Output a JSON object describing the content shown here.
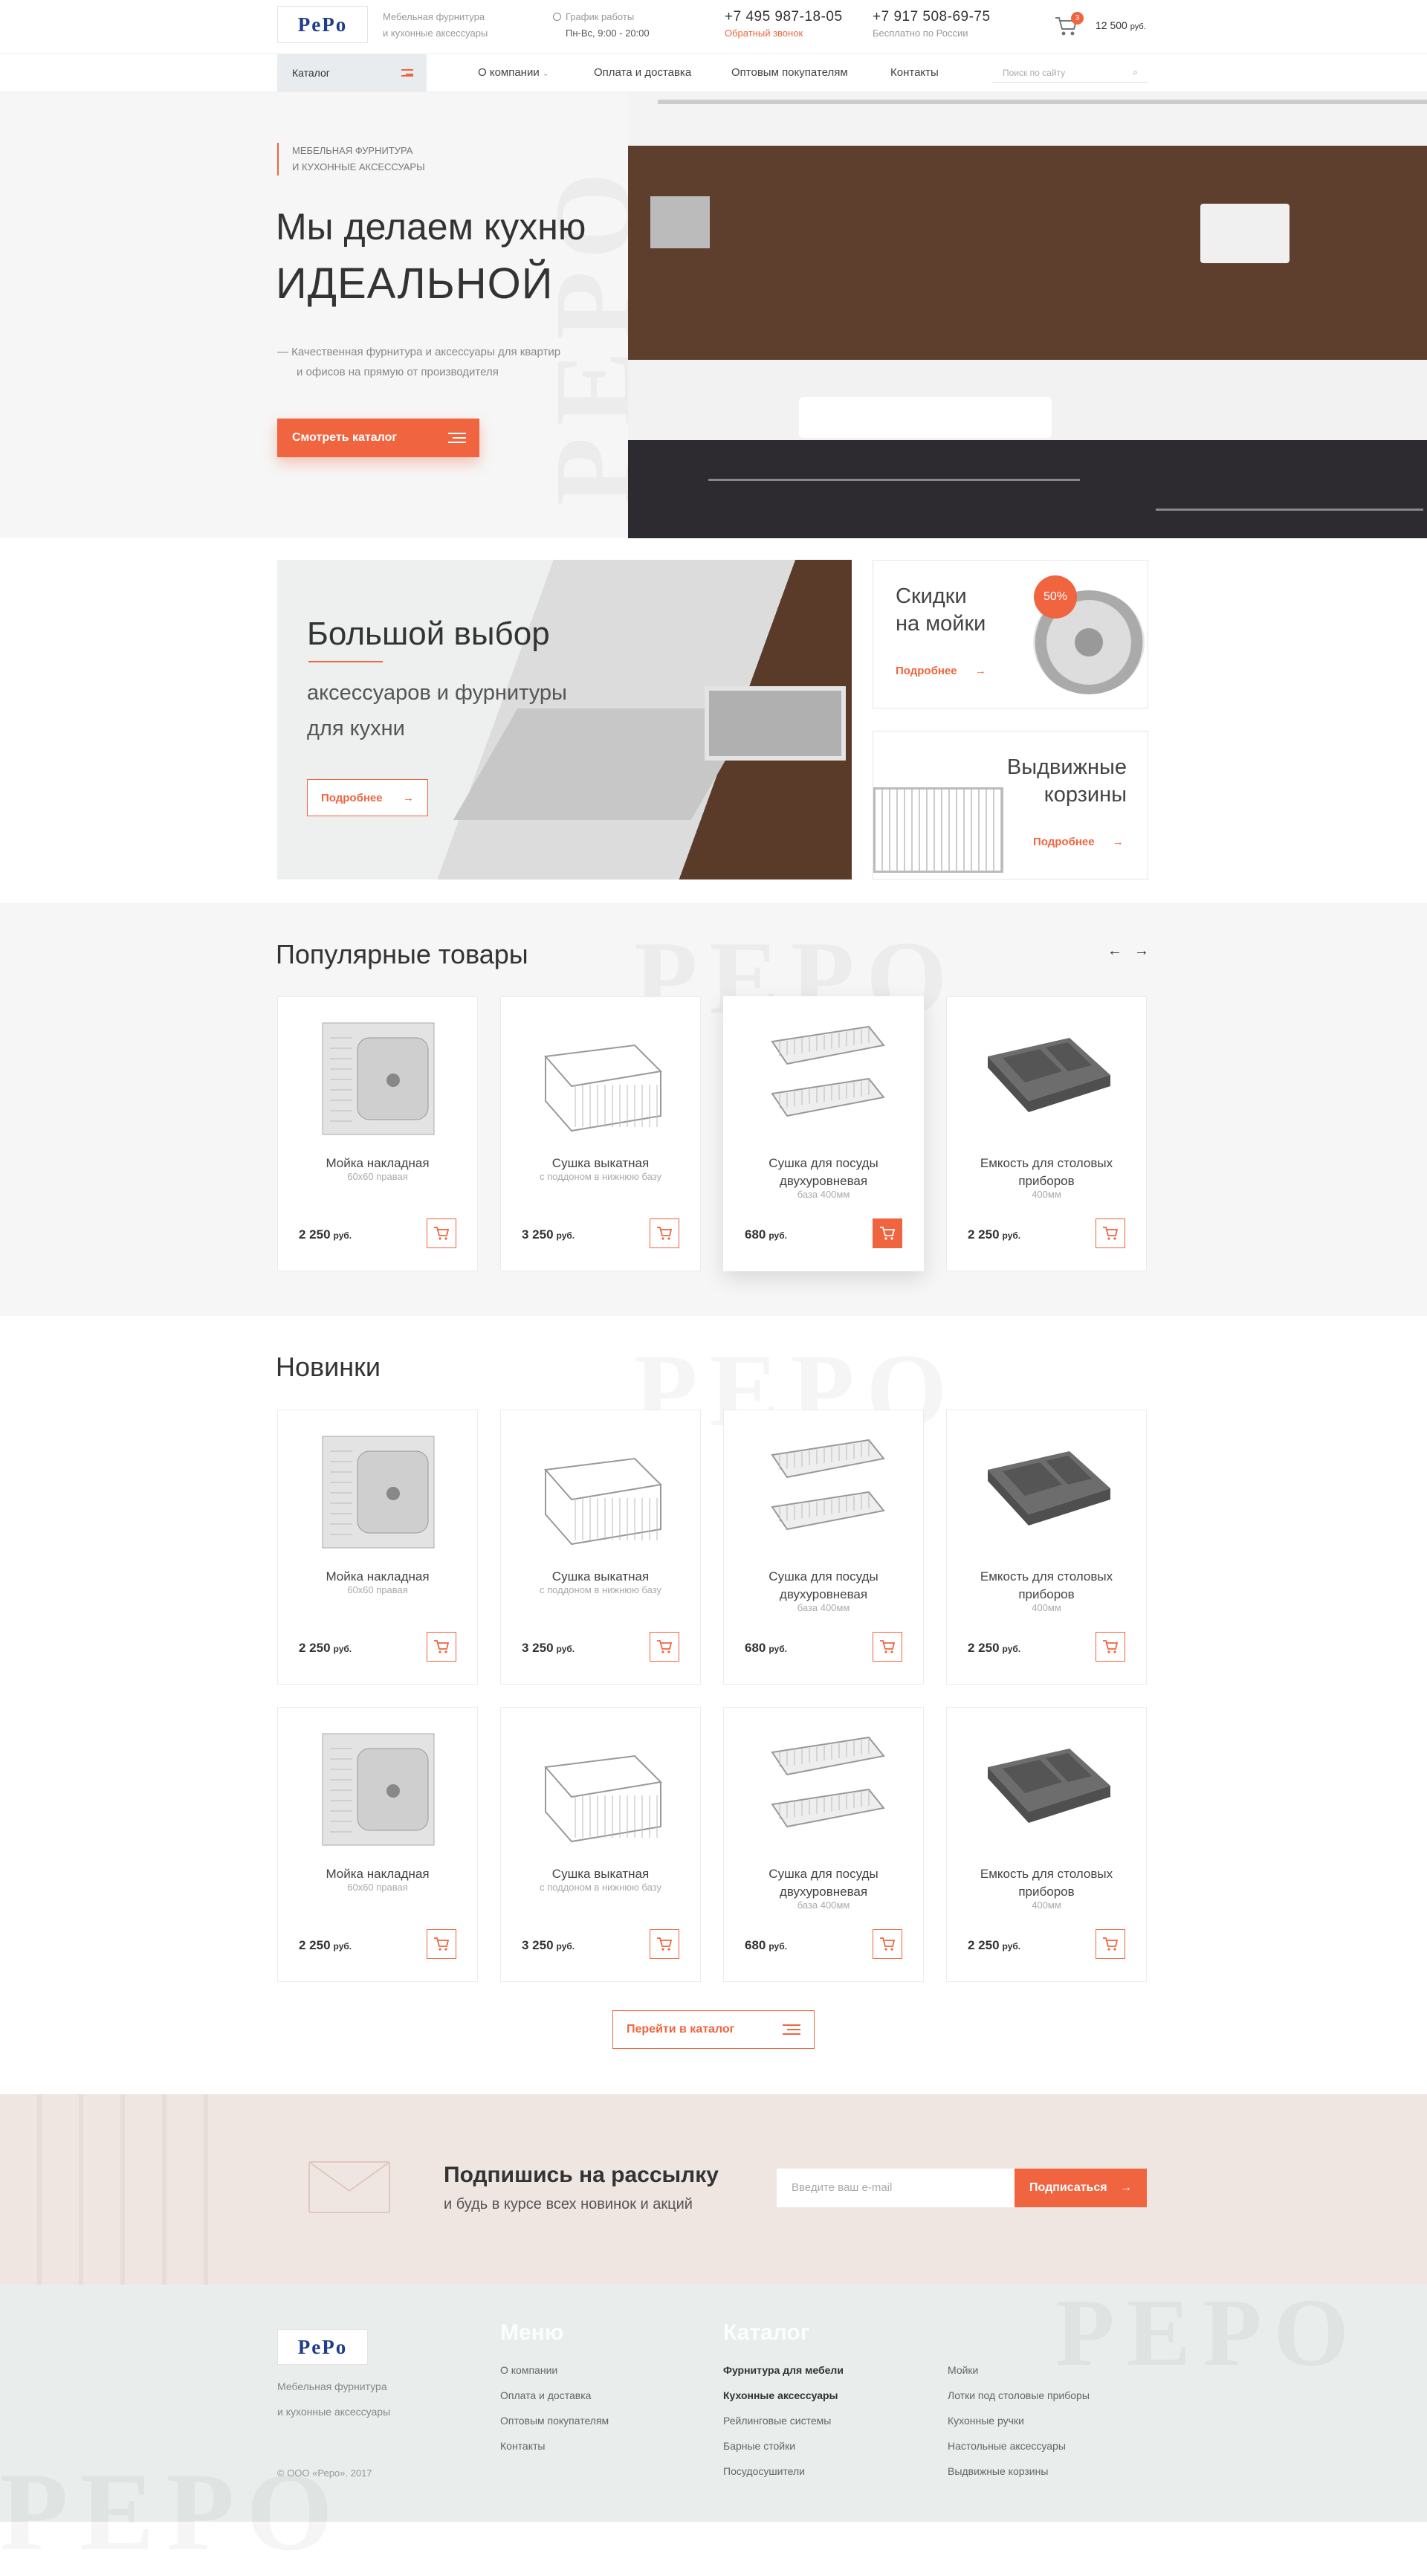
{
  "header": {
    "logo": "PePo",
    "tagline1": "Мебельная фурнитура",
    "tagline2": "и кухонные аксессуары",
    "schedule_label": "График работы",
    "schedule_value": "Пн-Вс, 9:00 - 20:00",
    "phone1": "+7 495 987-18-05",
    "phone1_note": "Обратный звонок",
    "phone2": "+7 917 508-69-75",
    "phone2_note": "Бесплатно по России",
    "cart_count": "3",
    "cart_total": "12 500",
    "currency": "руб."
  },
  "nav": {
    "catalog": "Каталог",
    "items": [
      "О компании",
      "Оплата и доставка",
      "Оптовым покупателям",
      "Контакты"
    ],
    "search_placeholder": "Поиск по сайту"
  },
  "hero": {
    "eyebrow1": "МЕБЕЛЬНАЯ ФУРНИТУРА",
    "eyebrow2": "И КУХОННЫЕ АКСЕССУАРЫ",
    "title1": "Мы делаем кухню",
    "title2": "ИДЕАЛЬНОЙ",
    "desc1": "Качественная фурнитура и аксессуары для квартир",
    "desc2": "и офисов на прямую от производителя",
    "button": "Смотреть каталог",
    "watermark": "PEPO"
  },
  "promo": {
    "big_title": "Большой выбор",
    "big_sub1": "аксессуаров и фурнитуры",
    "big_sub2": "для кухни",
    "big_button": "Подробнее",
    "sale_title1": "Скидки",
    "sale_title2": "на мойки",
    "sale_badge": "50%",
    "sale_link": "Подробнее",
    "baskets_title1": "Выдвижные",
    "baskets_title2": "корзины",
    "baskets_link": "Подробнее"
  },
  "popular": {
    "title": "Популярные товары",
    "watermark": "PEPO",
    "prev": "←",
    "next": "→"
  },
  "new": {
    "title": "Новинки",
    "watermark": "PEPO"
  },
  "products": [
    {
      "name": "Мойка накладная",
      "sub": "60х60 правая",
      "price": "2 250",
      "kind": "sink"
    },
    {
      "name": "Сушка выкатная",
      "sub": "с поддоном в нижнюю базу",
      "price": "3 250",
      "kind": "basket"
    },
    {
      "name": "Сушка для посуды двухуровневая",
      "sub": "база 400мм",
      "price": "680",
      "kind": "rack"
    },
    {
      "name": "Емкость для столовых приборов",
      "sub": "400мм",
      "price": "2 250",
      "kind": "tray"
    }
  ],
  "currency": "руб.",
  "catalog_button": "Перейти в каталог",
  "subscribe": {
    "title": "Подпишись на рассылку",
    "subtitle": "и будь в курсе всех новинок и акций",
    "placeholder": "Введите ваш e-mail",
    "button": "Подписаться"
  },
  "footer": {
    "logo": "PePo",
    "tagline1": "Мебельная фурнитура",
    "tagline2": "и кухонные аксессуары",
    "copyright": "© ООО «Реро». 2017",
    "menu_title": "Меню",
    "menu": [
      "О компании",
      "Оплата и доставка",
      "Оптовым покупателям",
      "Контакты"
    ],
    "catalog_title": "Каталог",
    "catalog_col1": [
      "Фурнитура для мебели",
      "Кухонные аксессуары",
      "Рейлинговые системы",
      "Барные стойки",
      "Посудосушители"
    ],
    "catalog_col2": [
      "Мойки",
      "Лотки под столовые приборы",
      "Кухонные ручки",
      "Настольные аксессуары",
      "Выдвижные корзины"
    ],
    "watermark": "PEPO"
  },
  "colors": {
    "accent": "#f0643f",
    "brand": "#1f3d8c"
  }
}
